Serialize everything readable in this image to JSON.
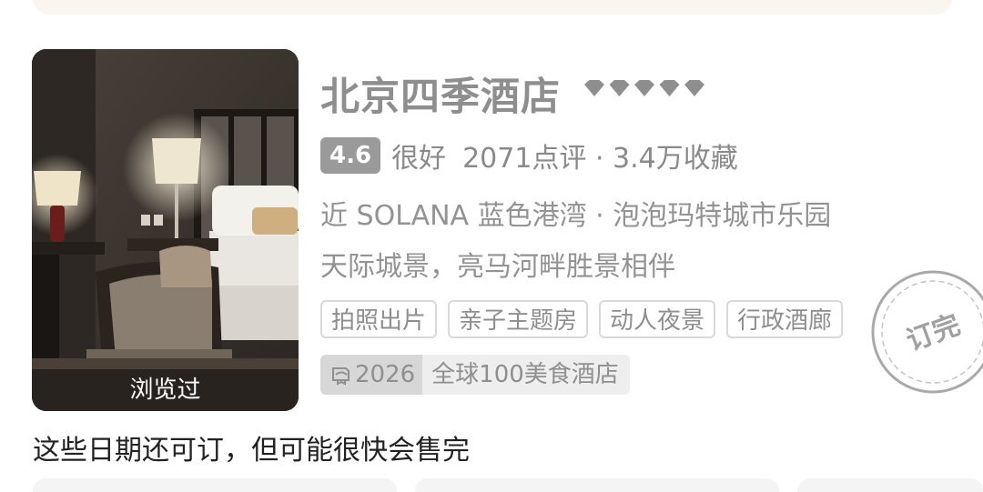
{
  "hotel": {
    "name": "北京四季酒店",
    "star_rating": 5,
    "score": "4.6",
    "rating_word": "很好",
    "review_info": "2071点评 · 3.4万收藏",
    "location": "近 SOLANA 蓝色港湾 · 泡泡玛特城市乐园",
    "description": "天际城景，亮马河畔胜景相伴",
    "tags": [
      "拍照出片",
      "亲子主题房",
      "动人夜景",
      "行政酒廊"
    ],
    "award_year": "2026",
    "award_title": "全球100美食酒店",
    "viewed_label": "浏览过",
    "status_stamp": "订完"
  },
  "availability_notice": "这些日期还可订，但可能很快会售完",
  "colors": {
    "muted_text": "#8e8e8e",
    "score_badge": "#9a9a9a",
    "tag_border": "#d9d9d9",
    "award_year_bg": "#d7d7d7",
    "award_title_bg": "#eeeeee",
    "notice_text": "#222222"
  },
  "icons": {
    "diamond": "diamond-icon",
    "award": "award-badge-icon"
  }
}
